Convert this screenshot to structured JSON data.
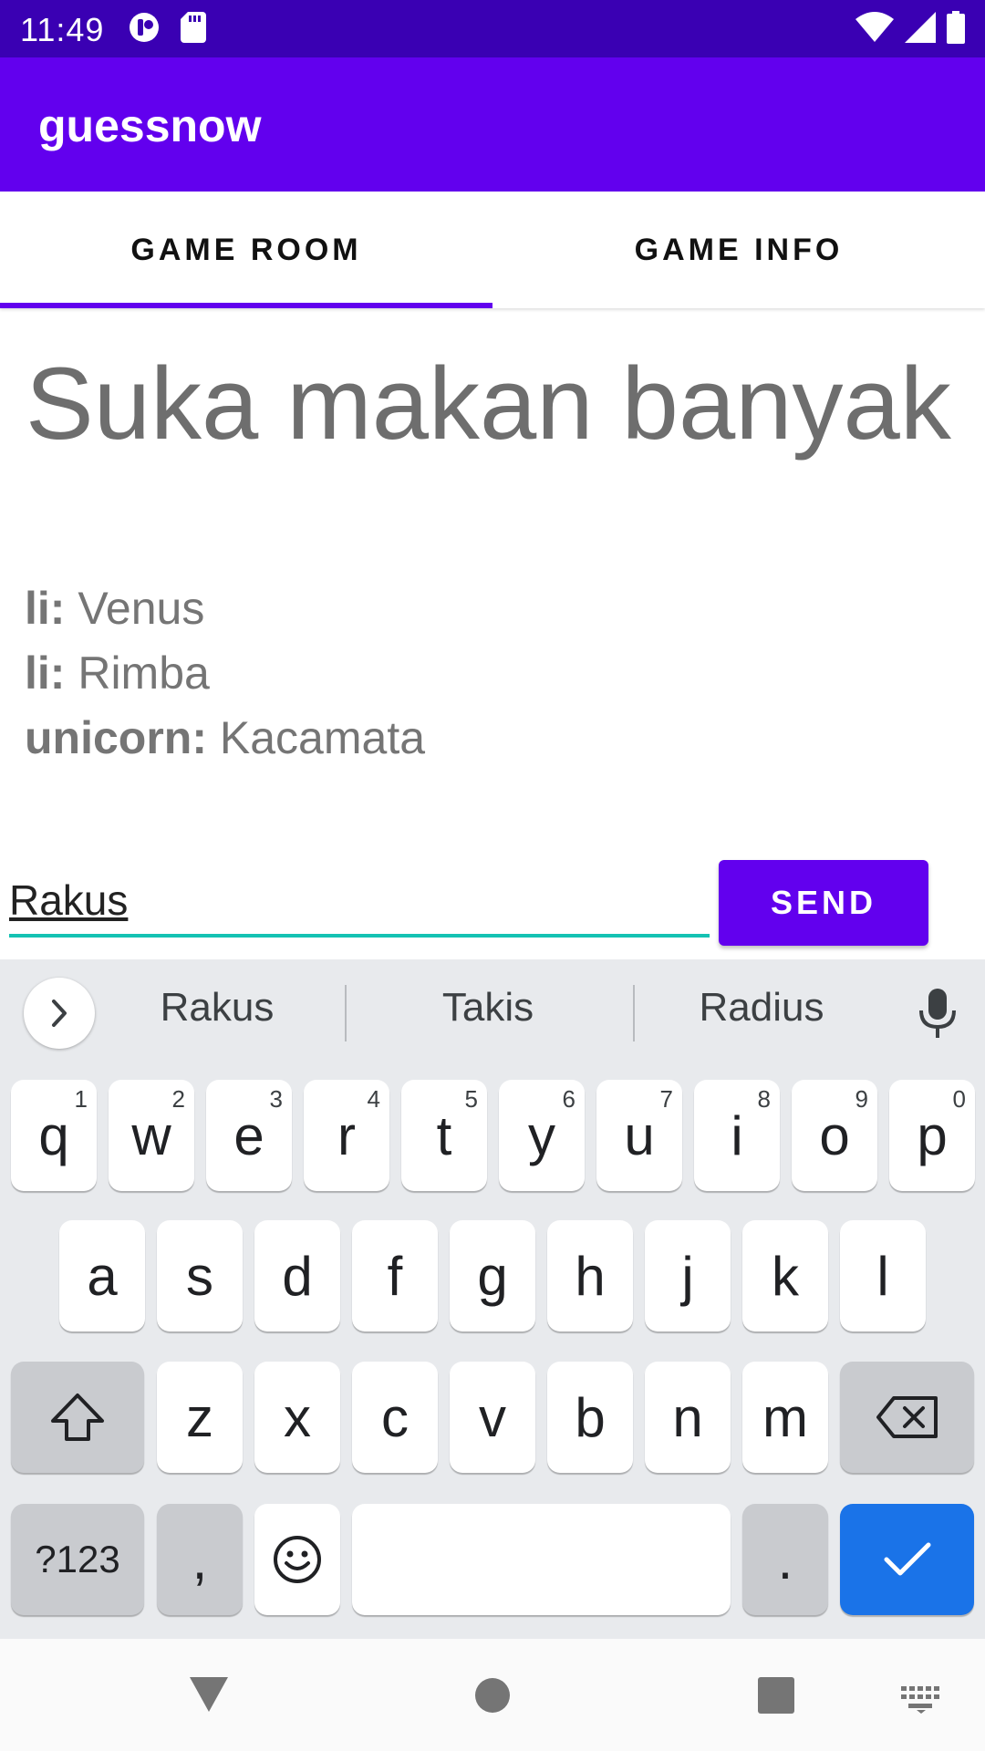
{
  "status_bar": {
    "time": "11:49",
    "left_icons": [
      "sync-icon",
      "sd-card-icon"
    ],
    "right_icons": [
      "wifi-icon",
      "signal-icon",
      "battery-icon"
    ]
  },
  "app_bar": {
    "title": "guessnow"
  },
  "tabs": [
    {
      "label": "GAME ROOM",
      "selected": true
    },
    {
      "label": "GAME INFO",
      "selected": false
    }
  ],
  "question": "Suka makan banyak",
  "guesses": [
    {
      "user": "li:",
      "answer": "Venus"
    },
    {
      "user": "li:",
      "answer": "Rimba"
    },
    {
      "user": "unicorn:",
      "answer": "Kacamata"
    }
  ],
  "answer_input": {
    "value": "Rakus"
  },
  "send_button": {
    "label": "SEND"
  },
  "colors": {
    "accent": "#6200ee",
    "status_bar": "#3a00b3",
    "input_underline": "#14c2b3",
    "keyboard_action": "#1a73e8"
  },
  "keyboard": {
    "suggestions": [
      "Rakus",
      "Takis",
      "Radius"
    ],
    "row1": [
      {
        "key": "q",
        "hint": "1"
      },
      {
        "key": "w",
        "hint": "2"
      },
      {
        "key": "e",
        "hint": "3"
      },
      {
        "key": "r",
        "hint": "4"
      },
      {
        "key": "t",
        "hint": "5"
      },
      {
        "key": "y",
        "hint": "6"
      },
      {
        "key": "u",
        "hint": "7"
      },
      {
        "key": "i",
        "hint": "8"
      },
      {
        "key": "o",
        "hint": "9"
      },
      {
        "key": "p",
        "hint": "0"
      }
    ],
    "row2": [
      "a",
      "s",
      "d",
      "f",
      "g",
      "h",
      "j",
      "k",
      "l"
    ],
    "row3": [
      "z",
      "x",
      "c",
      "v",
      "b",
      "n",
      "m"
    ],
    "symbols_label": "?123",
    "comma_label": ",",
    "period_label": "."
  }
}
